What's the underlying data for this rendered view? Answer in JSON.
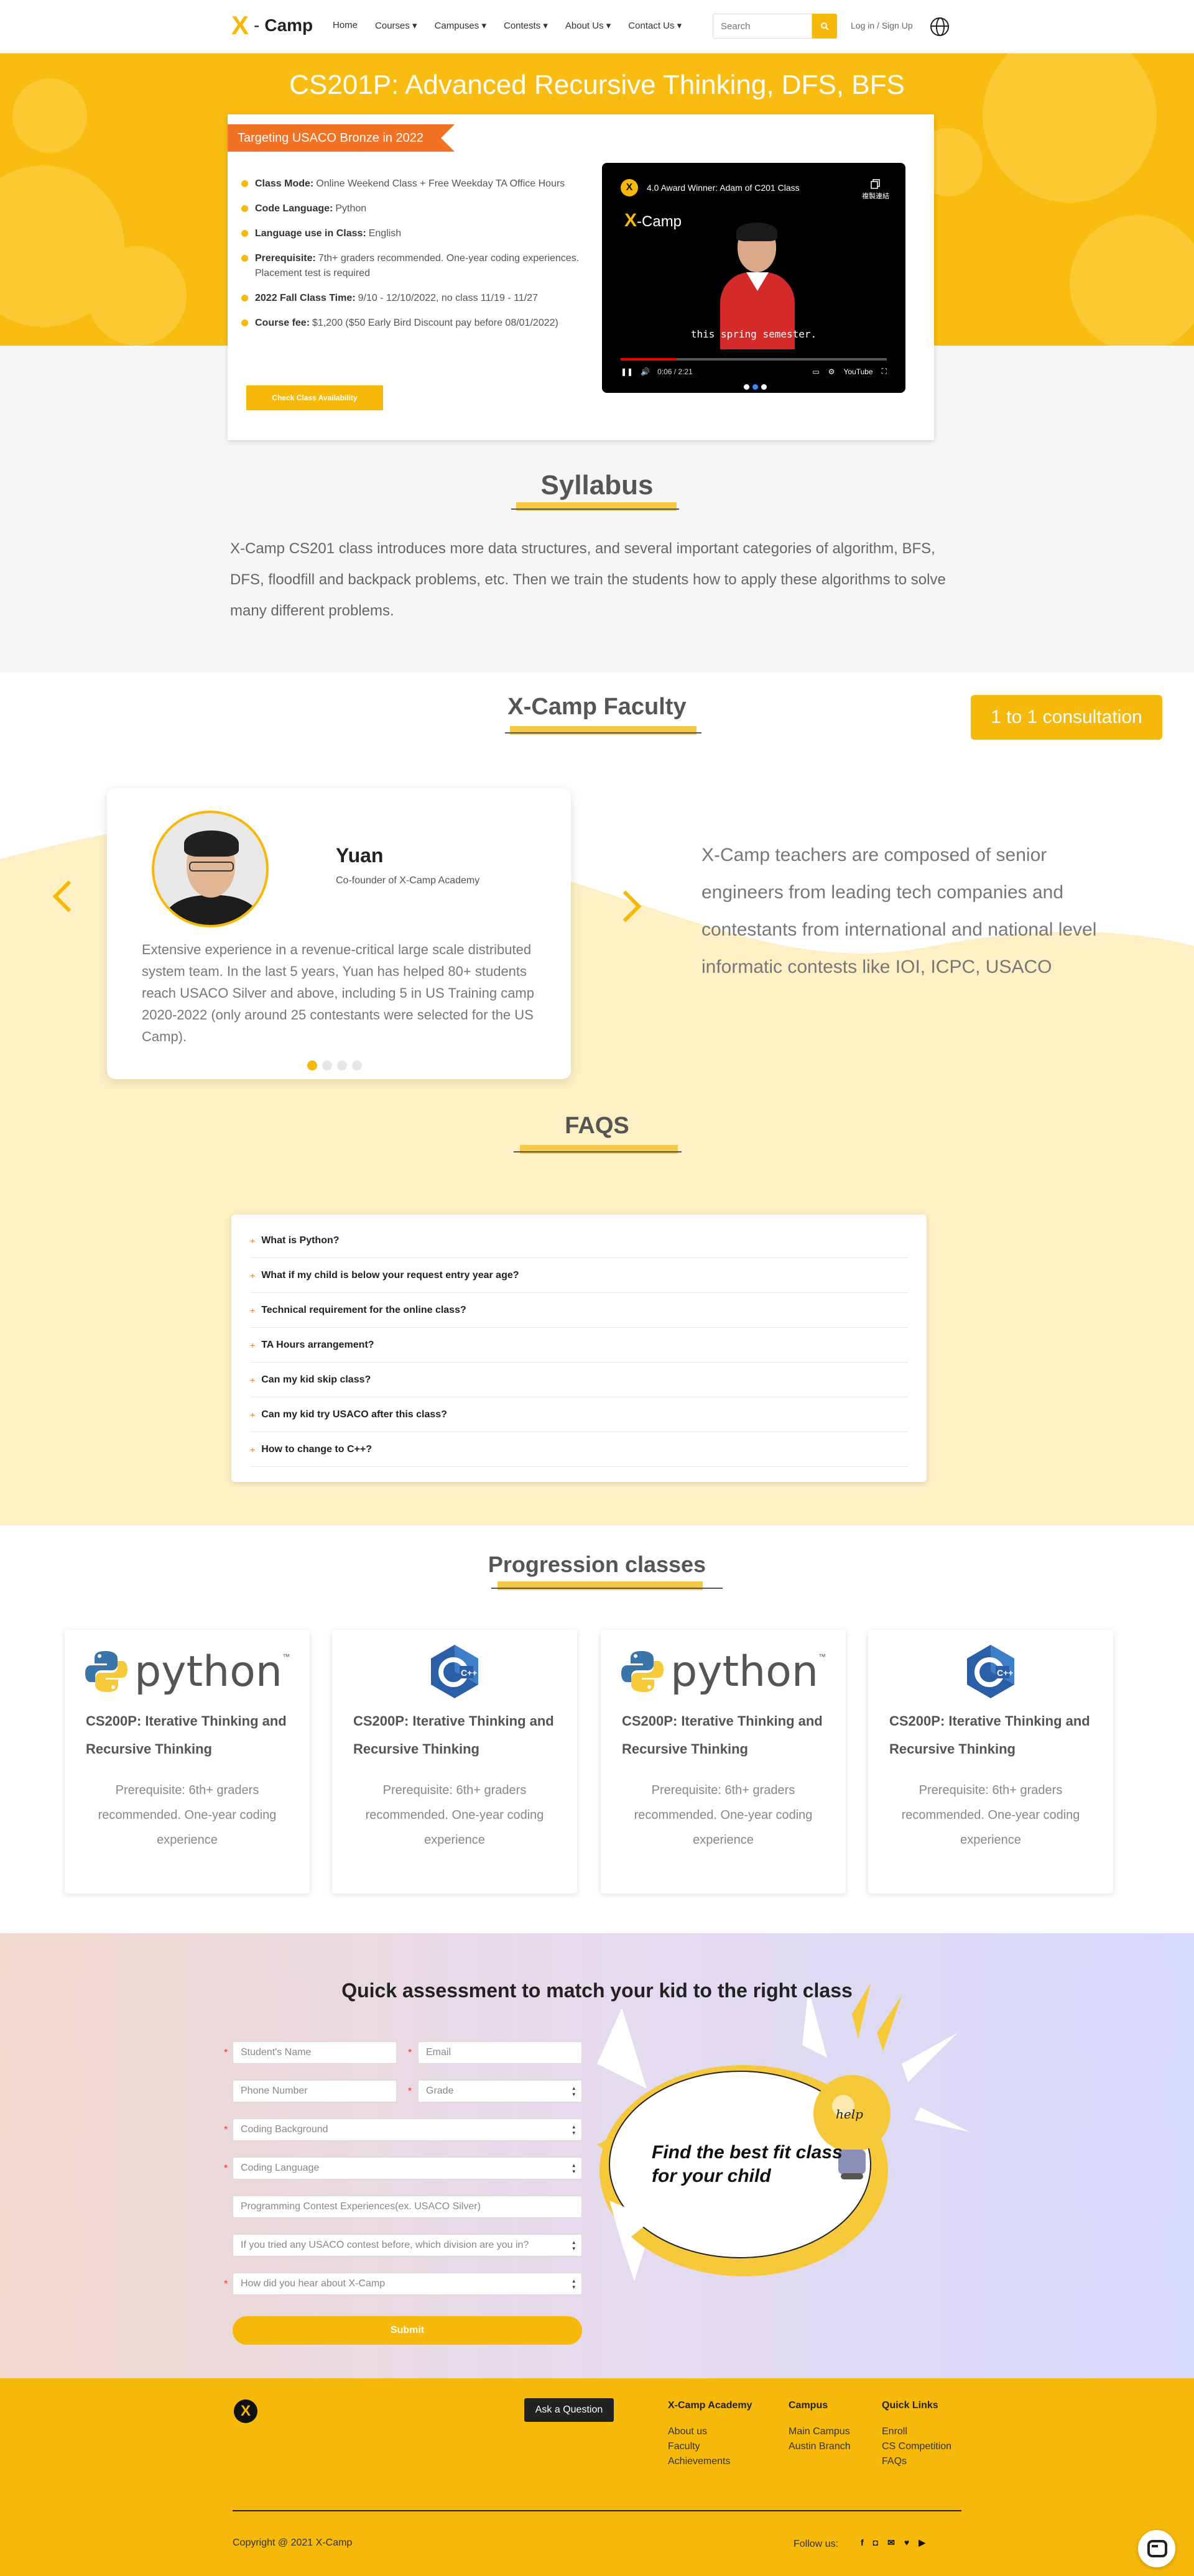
{
  "nav": {
    "logo_x": "X",
    "logo_dash": "-",
    "logo_text": "Camp",
    "items": [
      "Home",
      "Courses ▾",
      "Campuses ▾",
      "Contests ▾",
      "About Us ▾",
      "Contact Us ▾"
    ],
    "search_placeholder": "Search",
    "login": "Log in / Sign Up"
  },
  "hero": {
    "title": "CS201P: Advanced Recursive Thinking, DFS, BFS",
    "ribbon": "Targeting USACO Bronze in 2022",
    "info": [
      {
        "label": "Class Mode:",
        "value": "Online Weekend Class + Free Weekday TA Office Hours"
      },
      {
        "label": "Code Language:",
        "value": "Python"
      },
      {
        "label": "Language use in Class:",
        "value": "English"
      },
      {
        "label": "Prerequisite:",
        "value": "7th+ graders recommended. One-year coding experiences. Placement test is required"
      },
      {
        "label": "2022 Fall Class Time:",
        "value": "9/10 - 12/10/2022, no class 11/19 - 11/27"
      },
      {
        "label": "Course fee:",
        "value": "$1,200 ($50 Early Bird Discount pay before 08/01/2022)"
      }
    ],
    "cta": "Check Class Availability",
    "video": {
      "avatar": "X",
      "title": "4.0 Award Winner: Adam of C201 Class",
      "copy_label": "複製連結",
      "logo_x": "X",
      "logo_text": "-Camp",
      "subtitle": "this spring semester.",
      "time": "0:06 / 2:21",
      "youtube": "YouTube"
    }
  },
  "syllabus": {
    "title": "Syllabus",
    "text": "X-Camp CS201 class introduces more data structures, and several important categories of algorithm, BFS, DFS, floodfill and backpack problems, etc. Then we train the students how to apply these algorithms to solve many different problems."
  },
  "faculty": {
    "title": "X-Camp Faculty",
    "consult": "1 to 1 consultation",
    "name": "Yuan",
    "role": "Co-founder of X-Camp Academy",
    "bio": "Extensive experience in a revenue-critical large scale distributed system team. In the last 5 years, Yuan has helped 80+ students reach USACO Silver and above, including 5 in US Training camp 2020-2022 (only around 25 contestants were selected for the US Camp).",
    "description": "X-Camp teachers are composed of senior engineers from leading tech companies and contestants from international and national level informatic contests like IOI, ICPC, USACO"
  },
  "faq": {
    "title": "FAQS",
    "items": [
      "What is Python?",
      "What if my child is below your request entry year age?",
      "Technical requirement for the online class?",
      "TA Hours arrangement?",
      "Can my kid skip class?",
      "Can my kid try USACO after this class?",
      "How to change to C++?"
    ]
  },
  "progression": {
    "title": "Progression classes",
    "cards": [
      {
        "logo": "python",
        "logo_text": "python",
        "tm": "™",
        "title": "CS200P: Iterative Thinking and Recursive Thinking",
        "req": "Prerequisite: 6th+ graders recommended. One-year coding experience"
      },
      {
        "logo": "cpp",
        "logo_text": "C++",
        "tm": "",
        "title": "CS200P: Iterative Thinking and Recursive Thinking",
        "req": "Prerequisite: 6th+ graders recommended. One-year coding experience"
      },
      {
        "logo": "python",
        "logo_text": "python",
        "tm": "™",
        "title": "CS200P: Iterative Thinking and Recursive Thinking",
        "req": "Prerequisite: 6th+ graders recommended. One-year coding experience"
      },
      {
        "logo": "cpp",
        "logo_text": "C++",
        "tm": "",
        "title": "CS200P: Iterative Thinking and Recursive Thinking",
        "req": "Prerequisite: 6th+ graders recommended. One-year coding experience"
      }
    ]
  },
  "form": {
    "title": "Quick assessment to match your kid to the right class",
    "required_mark": "*",
    "student_name": "Student's Name",
    "email": "Email",
    "phone": "Phone Number",
    "grade": "Grade",
    "coding_background": "Coding Background",
    "coding_language": "Coding Language",
    "contest_experience": "Programming Contest Experiences(ex. USACO Silver)",
    "usaco_division": "If you tried any USACO contest before, which division are you in?",
    "heard_about": "How did you hear about X-Camp",
    "submit": "Submit",
    "bubble_line1": "Find the best fit class",
    "bubble_line2": "for your child",
    "bulb_text": "help"
  },
  "footer": {
    "logo": "X",
    "ask": "Ask a Question",
    "columns": [
      {
        "heading": "X-Camp Academy",
        "links": [
          "About us",
          "Faculty",
          "Achievements"
        ]
      },
      {
        "heading": "Campus",
        "links": [
          "Main Campus",
          "Austin Branch"
        ]
      },
      {
        "heading": "Quick Links",
        "links": [
          "Enroll",
          "CS Competition",
          "FAQs"
        ]
      }
    ],
    "copyright": "Copyright @ 2021 X-Camp",
    "follow": "Follow us:",
    "social": [
      "f",
      "◘",
      "✉",
      "♥",
      "▶"
    ]
  },
  "colors": {
    "brand": "#f6b90a",
    "ribbon": "#f37122",
    "light_yellow": "#fdf0c4"
  }
}
